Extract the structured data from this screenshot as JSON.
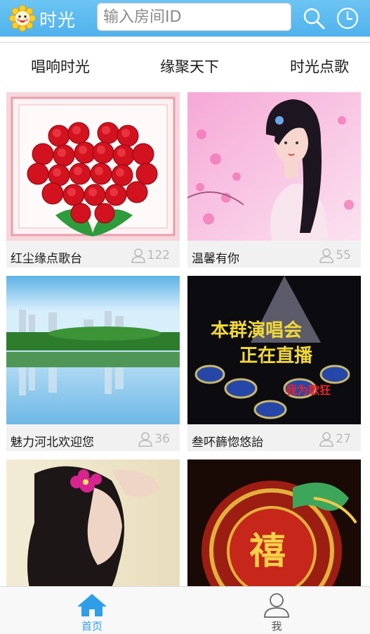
{
  "header": {
    "app_title": "时光",
    "search_placeholder": "输入房间ID",
    "logo_icon": "smiling-sun-icon",
    "search_icon": "search-icon",
    "history_icon": "clock-icon",
    "bg_color": "#58b8ee"
  },
  "tabs": [
    {
      "label": "唱响时光"
    },
    {
      "label": "缘聚天下"
    },
    {
      "label": "时光点歌"
    }
  ],
  "rooms": [
    {
      "name": "红尘缘点歌台",
      "count": "122",
      "image": "red-roses-heart"
    },
    {
      "name": "温馨有你",
      "count": "55",
      "image": "woman-pink-blossoms"
    },
    {
      "name": "魅力河北欢迎您",
      "count": "36",
      "image": "city-lake-reflection"
    },
    {
      "name": "叁吥籂惚悠詒",
      "count": "27",
      "image": "concert-stage-poster"
    },
    {
      "name": "",
      "count": "",
      "image": "woman-with-flower"
    },
    {
      "name": "",
      "count": "",
      "image": "dragon-fu-emblem"
    }
  ],
  "bottom_nav": [
    {
      "label": "首页",
      "icon": "home-icon",
      "active": true
    },
    {
      "label": "我",
      "icon": "user-icon",
      "active": false
    }
  ],
  "colors": {
    "accent": "#2f9ee6",
    "muted": "#b9b9b9"
  }
}
